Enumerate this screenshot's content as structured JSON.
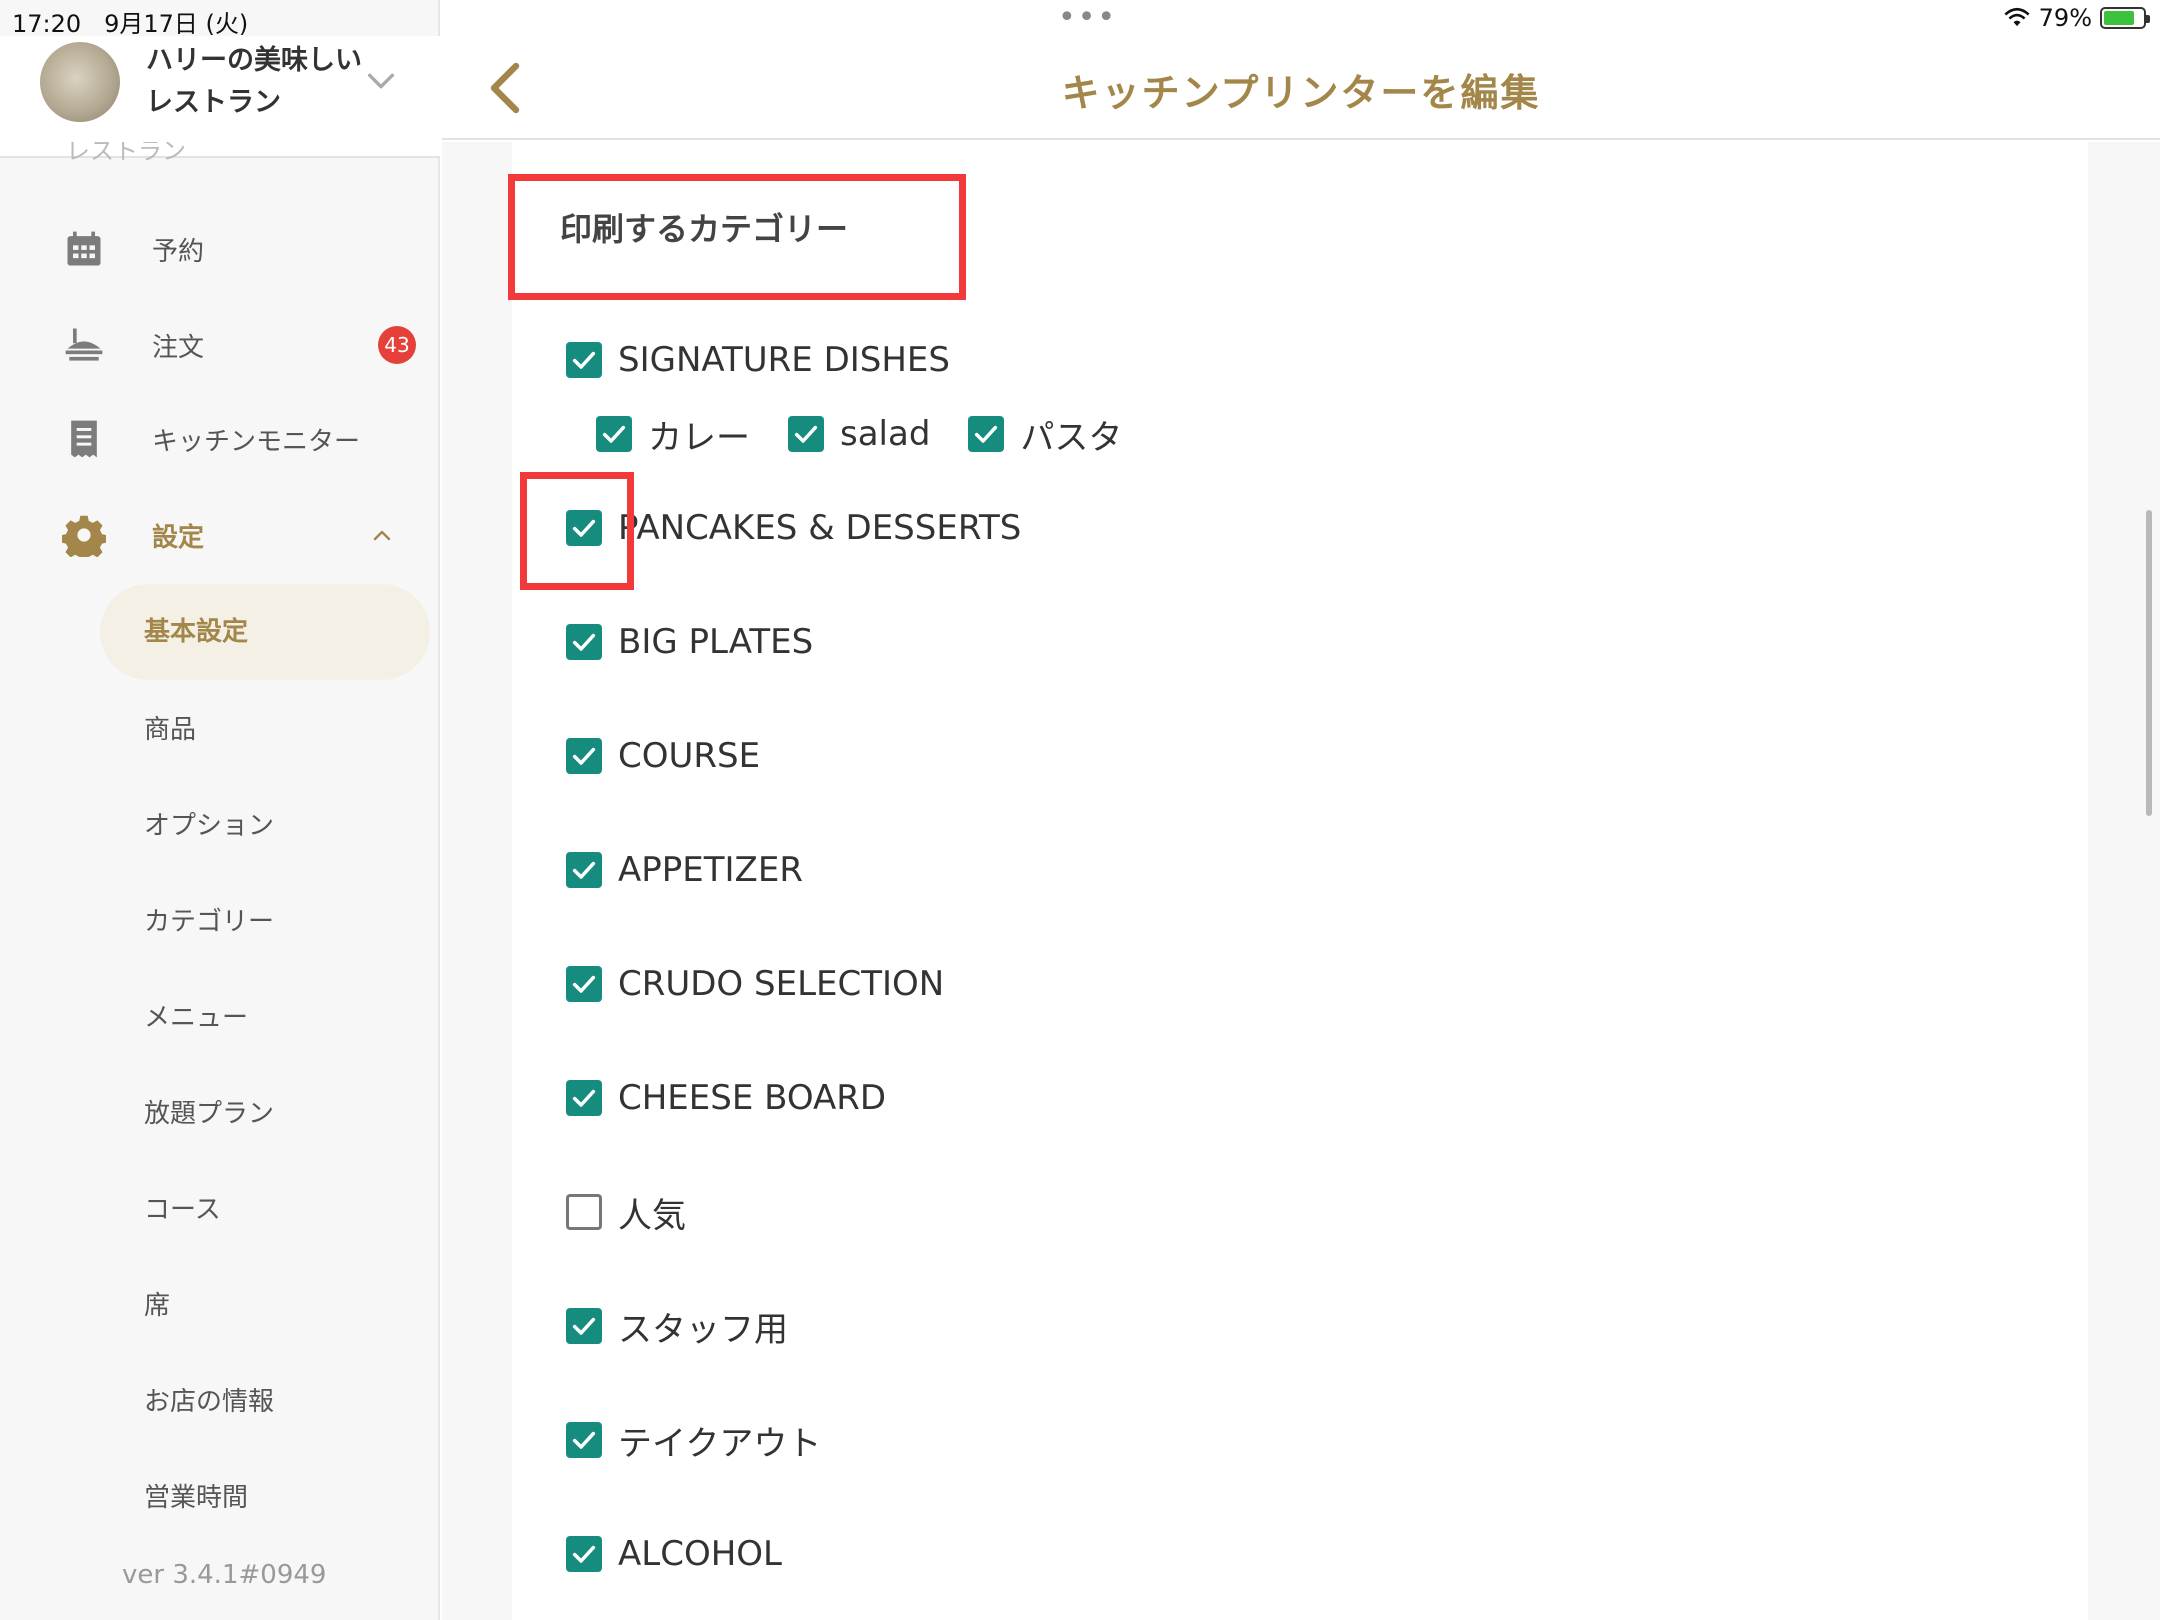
{
  "status_bar": {
    "time": "17:20",
    "date": "9月17日 (火)",
    "dots": "•••",
    "battery_pct": "79%",
    "battery_level": 0.79
  },
  "account": {
    "name": "ハリーの美味しいレストラン",
    "cut_text": "レストラン"
  },
  "sidebar": {
    "nav": [
      {
        "label": "予約",
        "icon": "calendar-icon"
      },
      {
        "label": "注文",
        "icon": "order-tray-icon",
        "badge": "43"
      },
      {
        "label": "キッチンモニター",
        "icon": "receipt-icon"
      },
      {
        "label": "設定",
        "icon": "gear-icon"
      }
    ],
    "settings_items": [
      "基本設定",
      "商品",
      "オプション",
      "カテゴリー",
      "メニュー",
      "放題プラン",
      "コース",
      "席",
      "お店の情報",
      "営業時間"
    ],
    "selected": "基本設定",
    "version": "ver 3.4.1#0949"
  },
  "header": {
    "title": "キッチンプリンターを編集"
  },
  "form": {
    "section_title": "印刷するカテゴリー",
    "categories": [
      {
        "label": "SIGNATURE DISHES",
        "checked": true
      },
      {
        "label": "PANCAKES & DESSERTS",
        "checked": true
      },
      {
        "label": "BIG PLATES",
        "checked": true
      },
      {
        "label": "COURSE",
        "checked": true
      },
      {
        "label": "APPETIZER",
        "checked": true
      },
      {
        "label": "CRUDO SELECTION",
        "checked": true
      },
      {
        "label": "CHEESE BOARD",
        "checked": true
      },
      {
        "label": "人気",
        "checked": false
      },
      {
        "label": "スタッフ用",
        "checked": true
      },
      {
        "label": "テイクアウト",
        "checked": true
      },
      {
        "label": "ALCOHOL",
        "checked": true
      }
    ],
    "signature_sub": [
      {
        "label": "カレー",
        "checked": true
      },
      {
        "label": "salad",
        "checked": true
      },
      {
        "label": "パスタ",
        "checked": true
      }
    ]
  },
  "colors": {
    "accent": "#a3864a",
    "checkbox": "#168c7f",
    "highlight": "#f23a3a",
    "badge": "#e5413a"
  }
}
